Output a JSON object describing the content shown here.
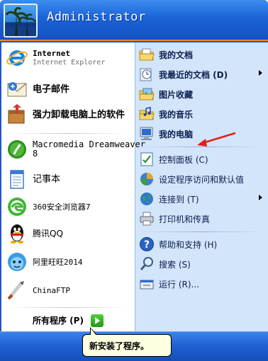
{
  "header": {
    "user_name": "Administrator"
  },
  "left_items": [
    {
      "main": "Internet",
      "sub": "Internet Explorer",
      "icon": "ie-icon"
    },
    {
      "main": "电子邮件",
      "icon": "email-icon"
    },
    {
      "main": "强力卸载电脑上的软件",
      "icon": "uninstall-icon"
    },
    {
      "main": "Macromedia Dreamweaver",
      "main2": "8",
      "icon": "dreamweaver-icon"
    },
    {
      "main": "记事本",
      "icon": "notepad-icon"
    },
    {
      "main": "360安全浏览器7",
      "icon": "360-browser-icon"
    },
    {
      "main": "腾讯QQ",
      "icon": "qq-icon"
    },
    {
      "main": "阿里旺旺2014",
      "icon": "wangwang-icon"
    },
    {
      "main": "ChinaFTP",
      "icon": "chinaftp-icon"
    }
  ],
  "all_programs": {
    "label": "所有程序 (P)"
  },
  "right_items": [
    {
      "label": "我的文档",
      "icon": "my-documents-icon",
      "bold": true
    },
    {
      "label": "我最近的文档 (D)",
      "icon": "recent-documents-icon",
      "bold": true,
      "submenu": true
    },
    {
      "label": "图片收藏",
      "icon": "my-pictures-icon",
      "bold": true
    },
    {
      "label": "我的音乐",
      "icon": "my-music-icon",
      "bold": true
    },
    {
      "label": "我的电脑",
      "icon": "my-computer-icon",
      "bold": true
    },
    {
      "label": "控制面板 (C)",
      "icon": "control-panel-icon"
    },
    {
      "label": "设定程序访问和默认值",
      "icon": "program-access-icon"
    },
    {
      "label": "连接到 (T)",
      "icon": "connect-to-icon",
      "submenu": true
    },
    {
      "label": "打印机和传真",
      "icon": "printers-icon"
    },
    {
      "label": "帮助和支持 (H)",
      "icon": "help-icon"
    },
    {
      "label": "搜索 (S)",
      "icon": "search-icon"
    },
    {
      "label": "运行 (R)...",
      "icon": "run-icon"
    }
  ],
  "tooltip": {
    "text": "新安装了程序。"
  },
  "colors": {
    "header_blue": "#1a63d8",
    "right_pane": "#d3e5fa",
    "accent_orange": "#e88b22",
    "tooltip_bg": "#ffffe1"
  }
}
